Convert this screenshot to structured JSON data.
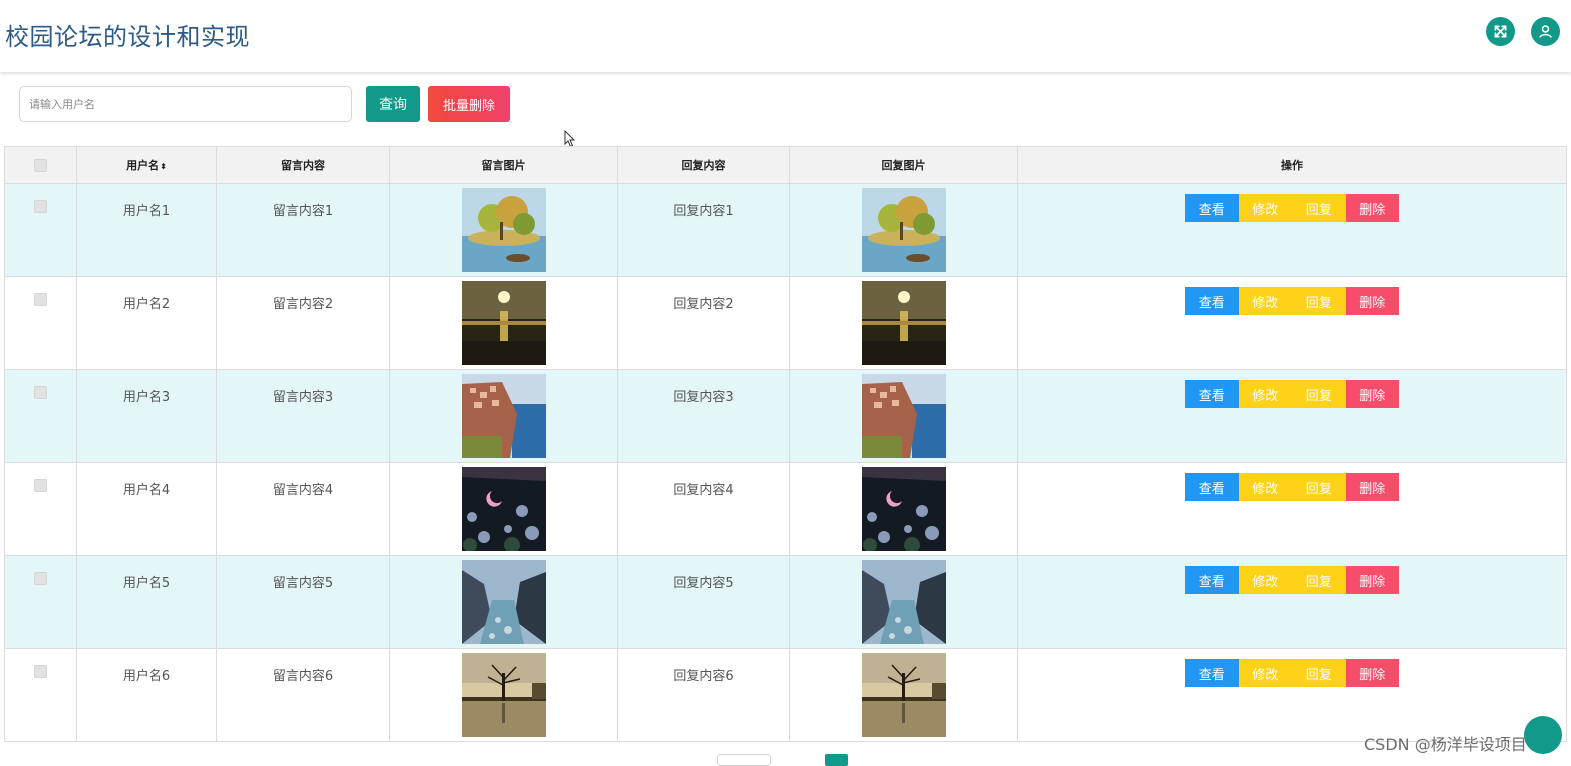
{
  "header": {
    "title": "校园论坛的设计和实现",
    "fullscreen_icon": "expand-arrows-icon",
    "user_icon": "user-icon"
  },
  "toolbar": {
    "search_placeholder": "请输入用户名",
    "search_value": "",
    "query_label": "查询",
    "batch_delete_label": "批量删除"
  },
  "table": {
    "columns": [
      "用户名",
      "留言内容",
      "留言图片",
      "回复内容",
      "回复图片",
      "操作"
    ],
    "sort_indicator": "⬍",
    "rows": [
      {
        "username": "用户名1",
        "message": "留言内容1",
        "reply": "回复内容1",
        "image": "lake-island-painting"
      },
      {
        "username": "用户名2",
        "message": "留言内容2",
        "reply": "回复内容2",
        "image": "sunset-beach"
      },
      {
        "username": "用户名3",
        "message": "留言内容3",
        "reply": "回复内容3",
        "image": "cliff-village"
      },
      {
        "username": "用户名4",
        "message": "留言内容4",
        "reply": "回复内容4",
        "image": "night-moon-flowers"
      },
      {
        "username": "用户名5",
        "message": "留言内容5",
        "reply": "回复内容5",
        "image": "mountain-river"
      },
      {
        "username": "用户名6",
        "message": "留言内容6",
        "reply": "回复内容6",
        "image": "lone-tree-lake"
      }
    ],
    "actions": {
      "view": "查看",
      "edit": "修改",
      "reply": "回复",
      "delete": "删除"
    }
  },
  "watermark": "CSDN @杨洋毕设项目",
  "colors": {
    "primary": "#12998a",
    "title": "#2d5b86",
    "view": "#2196f3",
    "edit": "#ffd21a",
    "delete": "#f54d6a",
    "row_highlight": "#e3f7f9"
  }
}
